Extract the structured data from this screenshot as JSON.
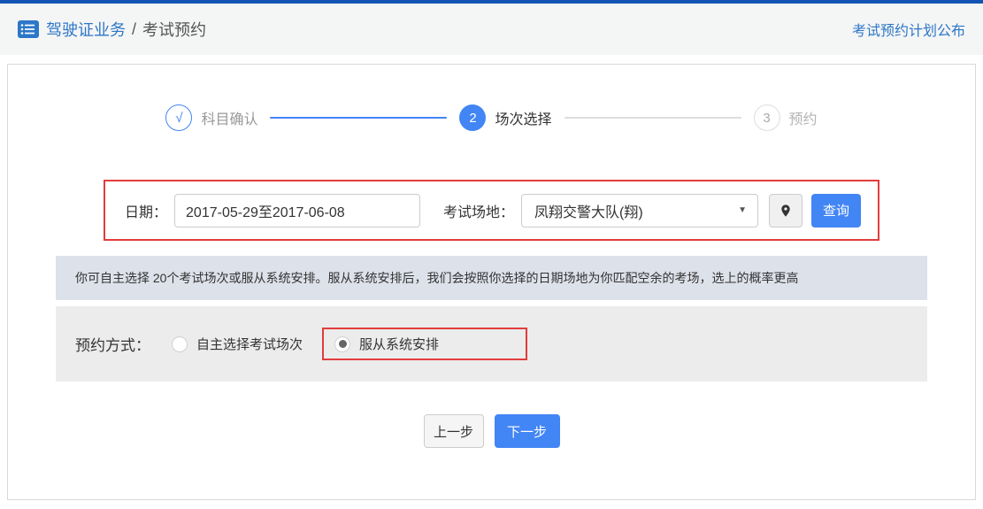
{
  "header": {
    "breadcrumb_primary": "驾驶证业务",
    "breadcrumb_separator": "/",
    "breadcrumb_secondary": "考试预约",
    "plan_link": "考试预约计划公布"
  },
  "stepper": {
    "steps": [
      {
        "marker": "√",
        "label": "科目确认",
        "state": "done"
      },
      {
        "marker": "2",
        "label": "场次选择",
        "state": "active"
      },
      {
        "marker": "3",
        "label": "预约",
        "state": "pending"
      }
    ]
  },
  "filter": {
    "date_label": "日期：",
    "date_value": "2017-05-29至2017-06-08",
    "venue_label": "考试场地：",
    "venue_value": "凤翔交警大队(翔)",
    "venue_caret": "▼",
    "search_button": "查询"
  },
  "notice": "你可自主选择 20个考试场次或服从系统安排。服从系统安排后，我们会按照你选择的日期场地为你匹配空余的考场，选上的概率更高",
  "booking": {
    "label": "预约方式：",
    "options": [
      {
        "label": "自主选择考试场次",
        "selected": false
      },
      {
        "label": "服从系统安排",
        "selected": true
      }
    ]
  },
  "actions": {
    "prev": "上一步",
    "next": "下一步"
  },
  "colors": {
    "accent_blue": "#4285f4",
    "link_blue": "#2d77c8",
    "top_bar_blue": "#1254b4",
    "highlight_red": "#e23c3c",
    "notice_bg": "#dde1ea",
    "booking_bg": "#ececec"
  }
}
